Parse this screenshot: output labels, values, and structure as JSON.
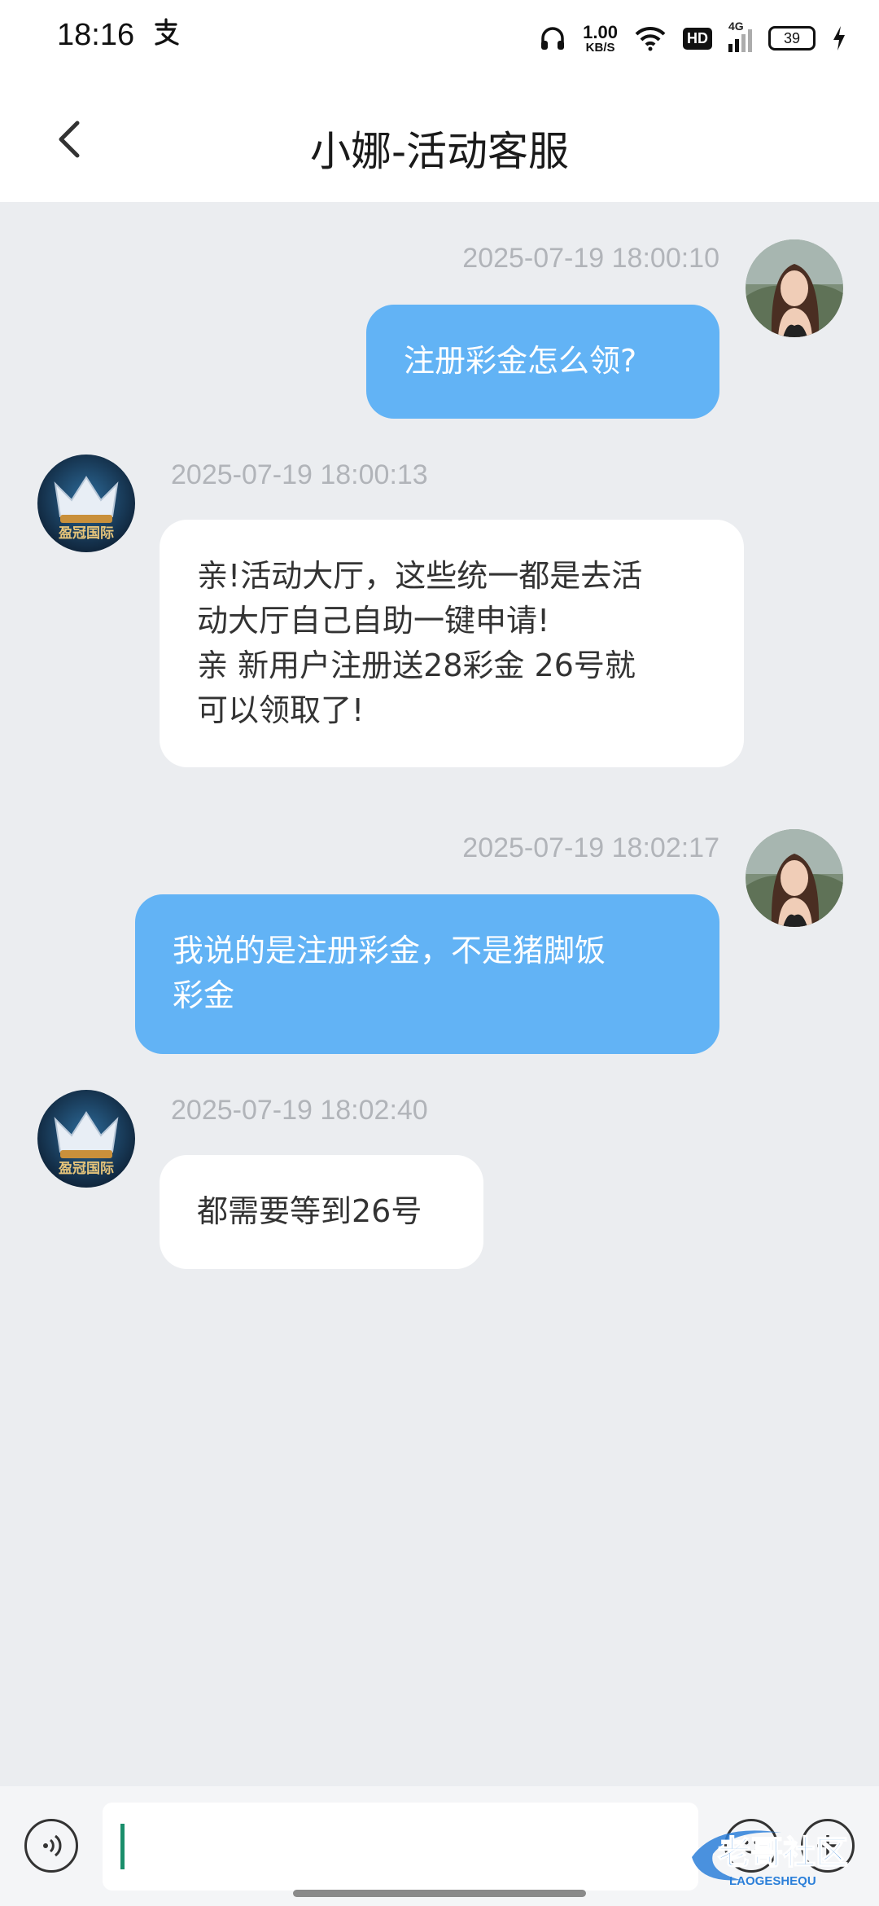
{
  "status_bar": {
    "time": "18:16",
    "notification_icon": "alipay-icon",
    "net_speed_value": "1.00",
    "net_speed_unit": "KB/S",
    "hd_label": "HD",
    "network_label": "4G",
    "battery_level": "39"
  },
  "header": {
    "title": "小娜-活动客服",
    "back_icon": "chevron-left-icon"
  },
  "messages": [
    {
      "sender": "me",
      "time": "2025-07-19 18:00:10",
      "text": "注册彩金怎么领?"
    },
    {
      "sender": "agent",
      "time": "2025-07-19 18:00:13",
      "text": "亲!活动大厅，这些统一都是去活\n动大厅自己自助一键申请!\n 亲 新用户注册送28彩金 26号就\n可以领取了!"
    },
    {
      "sender": "me",
      "time": "2025-07-19 18:02:17",
      "text": "我说的是注册彩金，不是猪脚饭\n彩金"
    },
    {
      "sender": "agent",
      "time": "2025-07-19 18:02:40",
      "text": "都需要等到26号"
    }
  ],
  "agent_avatar_text": "盈冠国际",
  "input_bar": {
    "voice_icon": "voice-icon",
    "emoji_icon": "emoji-icon",
    "plus_icon": "plus-icon",
    "placeholder": ""
  },
  "watermark": {
    "text": "老哥社区",
    "subtext": "LAOGESHEQU"
  },
  "colors": {
    "my_bubble": "#62b3f5",
    "their_bubble": "#ffffff",
    "chat_background": "#ebedf0",
    "timestamp": "#b1b4b9"
  }
}
